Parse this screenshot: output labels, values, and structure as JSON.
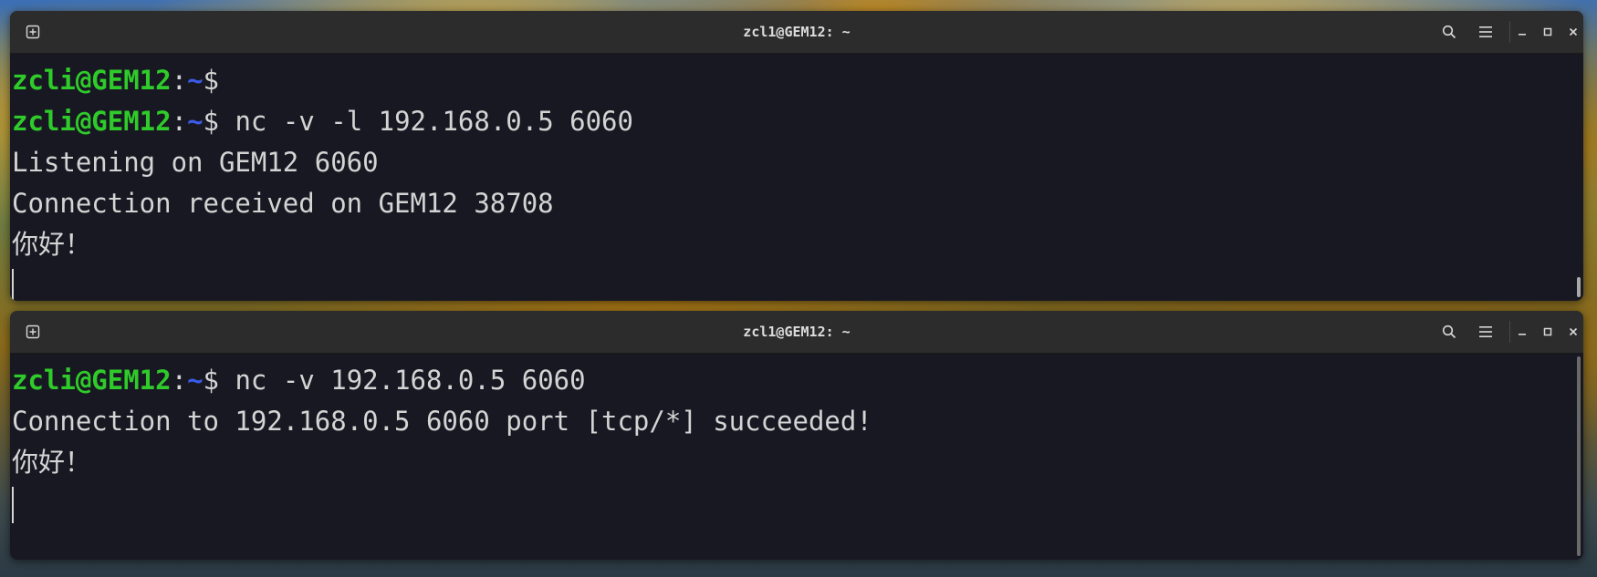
{
  "windows": {
    "top": {
      "title": "zcl1@GEM12: ~",
      "prompt_user": "zcli@GEM12",
      "prompt_colon": ":",
      "prompt_path": "~",
      "prompt_dollar": "$",
      "line1_cmd": "",
      "line2_cmd": " nc -v -l 192.168.0.5 6060",
      "line3": "Listening on GEM12 6060",
      "line4": "Connection received on GEM12 38708",
      "line5": "你好！"
    },
    "bottom": {
      "title": "zcl1@GEM12: ~",
      "prompt_user": "zcli@GEM12",
      "prompt_colon": ":",
      "prompt_path": "~",
      "prompt_dollar": "$",
      "line1_cmd": " nc -v 192.168.0.5 6060",
      "line2": "Connection to 192.168.0.5 6060 port [tcp/*] succeeded!",
      "line3": "你好！"
    }
  },
  "icons": {
    "new_tab": "new-tab-icon",
    "search": "search-icon",
    "menu": "hamburger-menu-icon",
    "minimize": "minimize-icon",
    "maximize": "maximize-icon",
    "close": "close-icon"
  },
  "colors": {
    "terminal_bg": "#181823",
    "titlebar_bg": "#2c2c2c",
    "prompt_user": "#2fcb2a",
    "prompt_path": "#3b5be8",
    "text": "#d4d4d4"
  }
}
